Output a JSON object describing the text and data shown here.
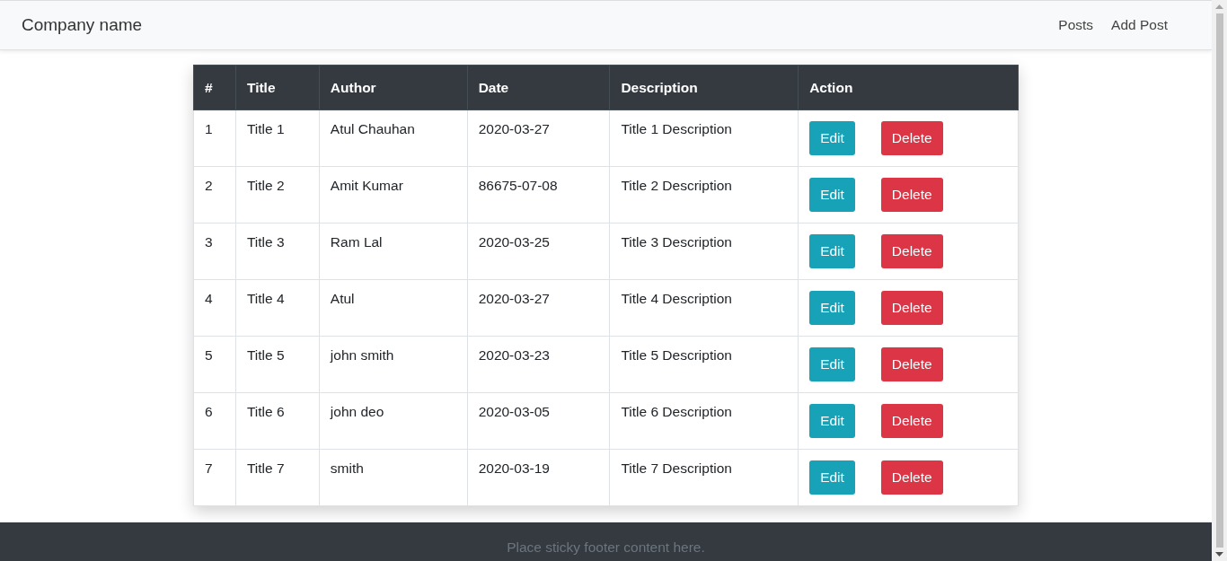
{
  "navbar": {
    "brand": "Company name",
    "links": [
      {
        "label": "Posts"
      },
      {
        "label": "Add Post"
      }
    ]
  },
  "table": {
    "columns": [
      "#",
      "Title",
      "Author",
      "Date",
      "Description",
      "Action"
    ],
    "rows": [
      {
        "cells": [
          "1",
          "Title 1",
          "Atul Chauhan",
          "2020-03-27",
          "Title 1 Description"
        ],
        "actions": [
          {
            "label": "Edit",
            "kind": "edit"
          },
          {
            "label": "Delete",
            "kind": "delete"
          }
        ]
      },
      {
        "cells": [
          "2",
          "Title 2",
          "Amit Kumar",
          "86675-07-08",
          "Title 2 Description"
        ],
        "actions": [
          {
            "label": "Edit",
            "kind": "edit"
          },
          {
            "label": "Delete",
            "kind": "delete"
          }
        ]
      },
      {
        "cells": [
          "3",
          "Title 3",
          "Ram Lal",
          "2020-03-25",
          "Title 3 Description"
        ],
        "actions": [
          {
            "label": "Edit",
            "kind": "edit"
          },
          {
            "label": "Delete",
            "kind": "delete"
          }
        ]
      },
      {
        "cells": [
          "4",
          "Title 4",
          "Atul",
          "2020-03-27",
          "Title 4 Description"
        ],
        "actions": [
          {
            "label": "Edit",
            "kind": "edit"
          },
          {
            "label": "Delete",
            "kind": "delete"
          }
        ]
      },
      {
        "cells": [
          "5",
          "Title 5",
          "john smith",
          "2020-03-23",
          "Title 5 Description"
        ],
        "actions": [
          {
            "label": "Edit",
            "kind": "edit"
          },
          {
            "label": "Delete",
            "kind": "delete"
          }
        ]
      },
      {
        "cells": [
          "6",
          "Title 6",
          "john deo",
          "2020-03-05",
          "Title 6 Description"
        ],
        "actions": [
          {
            "label": "Edit",
            "kind": "edit"
          },
          {
            "label": "Delete",
            "kind": "delete"
          }
        ]
      },
      {
        "cells": [
          "7",
          "Title 7",
          "smith",
          "2020-03-19",
          "Title 7 Description"
        ],
        "actions": [
          {
            "label": "Edit",
            "kind": "edit"
          },
          {
            "label": "Delete",
            "kind": "delete"
          }
        ]
      }
    ]
  },
  "footer": {
    "text": "Place sticky footer content here."
  }
}
